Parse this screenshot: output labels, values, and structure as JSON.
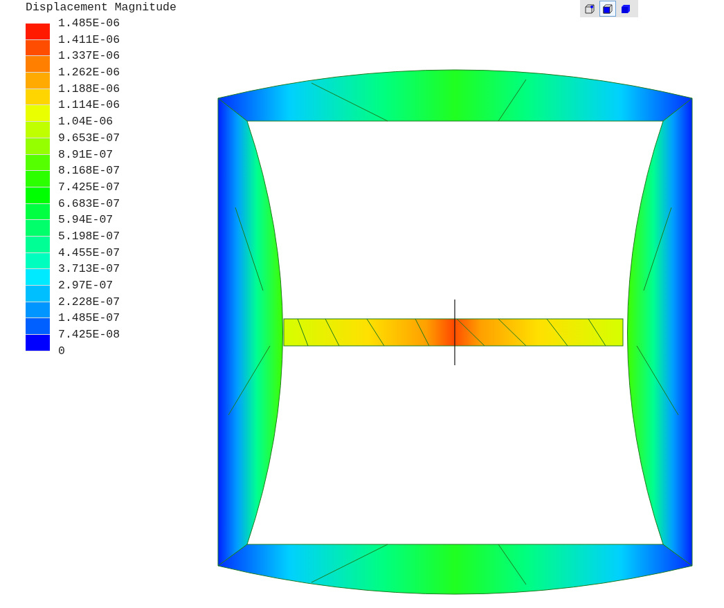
{
  "legend": {
    "title": "Displacement Magnitude",
    "swatches": [
      {
        "color": "#ff1a00"
      },
      {
        "color": "#ff4d00"
      },
      {
        "color": "#ff8000"
      },
      {
        "color": "#ffaa00"
      },
      {
        "color": "#ffd500"
      },
      {
        "color": "#eaff00"
      },
      {
        "color": "#bfff00"
      },
      {
        "color": "#95ff00"
      },
      {
        "color": "#55ff00"
      },
      {
        "color": "#2bff00"
      },
      {
        "color": "#00ff00"
      },
      {
        "color": "#00ff40"
      },
      {
        "color": "#00ff6a"
      },
      {
        "color": "#00ff95"
      },
      {
        "color": "#00ffbf"
      },
      {
        "color": "#00eaff"
      },
      {
        "color": "#00bfff"
      },
      {
        "color": "#0095ff"
      },
      {
        "color": "#0060ff"
      },
      {
        "color": "#0000ff"
      }
    ],
    "labels": [
      "1.485E-06",
      "1.411E-06",
      "1.337E-06",
      "1.262E-06",
      "1.188E-06",
      "1.114E-06",
      "1.04E-06",
      "9.653E-07",
      "8.91E-07",
      "8.168E-07",
      "7.425E-07",
      "6.683E-07",
      "5.94E-07",
      "5.198E-07",
      "4.455E-07",
      "3.713E-07",
      "2.97E-07",
      "2.228E-07",
      "1.485E-07",
      "7.425E-08",
      "0"
    ]
  },
  "toolbar": [
    {
      "kind": "wireframe",
      "selected": false
    },
    {
      "kind": "shaded-edges",
      "selected": true
    },
    {
      "kind": "shaded",
      "selected": false
    }
  ]
}
